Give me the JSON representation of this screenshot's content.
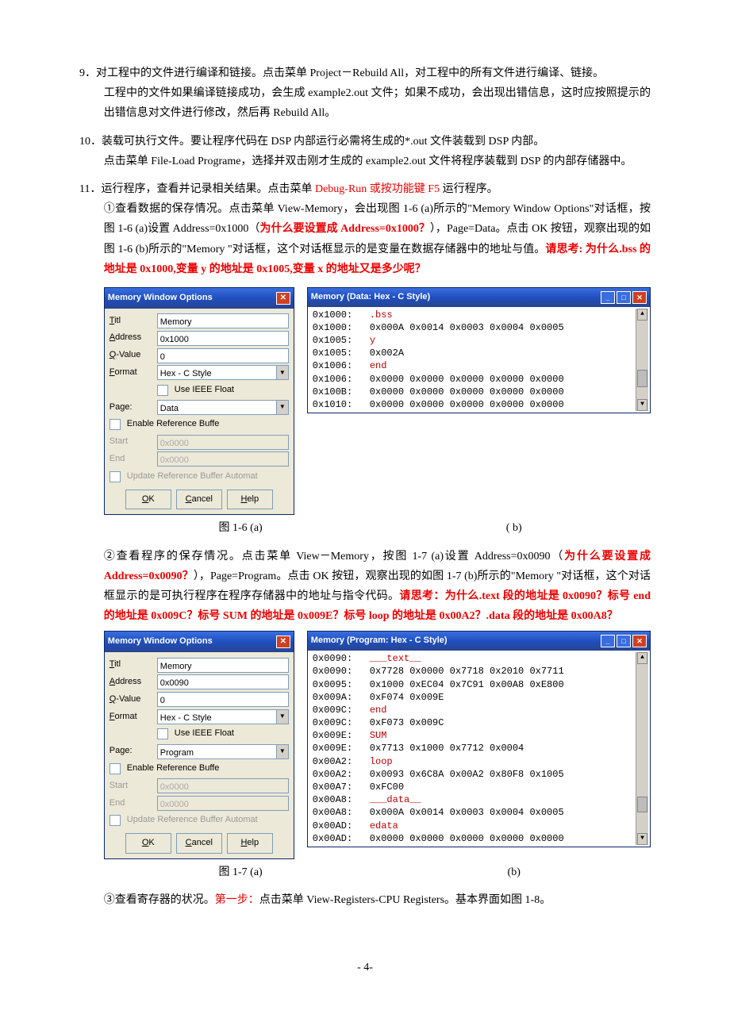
{
  "steps": {
    "s9": {
      "num": "9．",
      "l1": "对工程中的文件进行编译和链接。点击菜单 Project－Rebuild All，对工程中的所有文件进行编译、链接。",
      "l2": "工程中的文件如果编译链接成功，会生成 example2.out 文件；如果不成功，会出现出错信息，这时应按照提示的出错信息对文件进行修改，然后再 Rebuild All。"
    },
    "s10": {
      "num": "10．",
      "l1": "装载可执行文件。要让程序代码在 DSP 内部运行必需将生成的*.out 文件装载到 DSP 内部。",
      "l2": "点击菜单 File-Load Programe，选择并双击刚才生成的 example2.out 文件将程序装载到 DSP 的内部存储器中。"
    },
    "s11": {
      "num": "11．",
      "l1a": "运行程序，查看并记录相关结果。点击菜单 ",
      "l1b": "Debug-Run 或按功能键 F5 ",
      "l1c": "运行程序。",
      "c1a": "①查看数据的保存情况。点击菜单 View-Memory，会出现图 1-6 (a)所示的\"Memory Window Options\"对话框，按图 1-6 (a)设置 Address=0x1000（",
      "c1b": "为什么要设置成 Address=0x1000？",
      "c1c": "），Page=Data。点击 OK 按钮，观察出现的如图 1-6 (b)所示的\"Memory \"对话框，这个对话框显示的是变量在数据存储器中的地址与值。",
      "c1d": "请思考: 为什么.bss 的地址是 0x1000,变量 y 的地址是 0x1005,变量 x 的地址又是多少呢？",
      "c2a": "②查看程序的保存情况。点击菜单 View－Memory，按图 1-7 (a)设置 Address=0x0090（",
      "c2b": "为什么要设置成 Address=0x0090？",
      "c2c": "），Page=Program。点击 OK 按钮，观察出现的如图 1-7 (b)所示的\"Memory \"对话框，这个对话框显示的是可执行程序在程序存储器中的地址与指令代码。",
      "c2d": "请思考：为什么.text 段的地址是 0x0090？标号 end 的地址是 0x009C？标号 SUM 的地址是 0x009E？标号 loop 的地址是 0x00A2？.data 段的地址是 0x00A8？",
      "c3a": "③查看寄存器的状况。",
      "c3b": "第一步：",
      "c3c": "点击菜单 View-Registers-CPU Registers。基本界面如图 1-8。"
    }
  },
  "dlg": {
    "title": "Memory Window Options",
    "labels": {
      "titl": "Titl",
      "address": "Address",
      "qvalue": "Q-Value",
      "format": "Format",
      "page": "Page:",
      "start": "Start",
      "end": "End"
    },
    "ieee": "Use IEEE Float",
    "refbuf": "Enable Reference Buffe",
    "updref": "Update Reference Buffer Automat",
    "btn": {
      "ok": "OK",
      "cancel": "Cancel",
      "help": "Help"
    },
    "a": {
      "addr": "0x1000",
      "qv": "0",
      "fmt": "Hex - C Style",
      "page": "Data",
      "start": "0x0000",
      "end": "0x0000",
      "titl": "Memory"
    },
    "b": {
      "addr": "0x0090",
      "qv": "0",
      "fmt": "Hex - C Style",
      "page": "Program",
      "start": "0x0000",
      "end": "0x0000",
      "titl": "Memory"
    }
  },
  "mem1": {
    "title": "Memory (Data: Hex - C Style)",
    "lines": [
      {
        "addr": "0x1000:",
        "lbl": ".bss"
      },
      {
        "addr": "0x1000:",
        "vals": "0x000A 0x0014 0x0003 0x0004 0x0005"
      },
      {
        "addr": "0x1005:",
        "lbl": "y"
      },
      {
        "addr": "0x1005:",
        "vals": "0x002A"
      },
      {
        "addr": "0x1006:",
        "lbl": "end"
      },
      {
        "addr": "0x1006:",
        "vals": "0x0000 0x0000 0x0000 0x0000 0x0000"
      },
      {
        "addr": "0x100B:",
        "vals": "0x0000 0x0000 0x0000 0x0000 0x0000"
      },
      {
        "addr": "0x1010:",
        "vals": "0x0000 0x0000 0x0000 0x0000 0x0000"
      }
    ]
  },
  "mem2": {
    "title": "Memory (Program: Hex - C Style)",
    "lines": [
      {
        "addr": "0x0090:",
        "lbl": "___text__"
      },
      {
        "addr": "0x0090:",
        "vals": "0x7728 0x0000 0x7718 0x2010 0x7711"
      },
      {
        "addr": "0x0095:",
        "vals": "0x1000 0xEC04 0x7C91 0x00A8 0xE800"
      },
      {
        "addr": "0x009A:",
        "vals": "0xF074 0x009E"
      },
      {
        "addr": "0x009C:",
        "lbl": "end"
      },
      {
        "addr": "0x009C:",
        "vals": "0xF073 0x009C"
      },
      {
        "addr": "0x009E:",
        "lbl": "SUM"
      },
      {
        "addr": "0x009E:",
        "vals": "0x7713 0x1000 0x7712 0x0004"
      },
      {
        "addr": "0x00A2:",
        "lbl": "loop"
      },
      {
        "addr": "0x00A2:",
        "vals": "0x0093 0x6C8A 0x00A2 0x80F8 0x1005"
      },
      {
        "addr": "0x00A7:",
        "vals": "0xFC00"
      },
      {
        "addr": "0x00A8:",
        "lbl": "___data__"
      },
      {
        "addr": "0x00A8:",
        "vals": "0x000A 0x0014 0x0003 0x0004 0x0005"
      },
      {
        "addr": "0x00AD:",
        "lbl": "edata"
      },
      {
        "addr": "0x00AD:",
        "vals": "0x0000 0x0000 0x0000 0x0000 0x0000"
      }
    ]
  },
  "caps": {
    "f16a": "图 1-6        (a)",
    "f16b": "( b)",
    "f17a": "图 1-7        (a)",
    "f17b": "(b)"
  },
  "page": "- 4-"
}
